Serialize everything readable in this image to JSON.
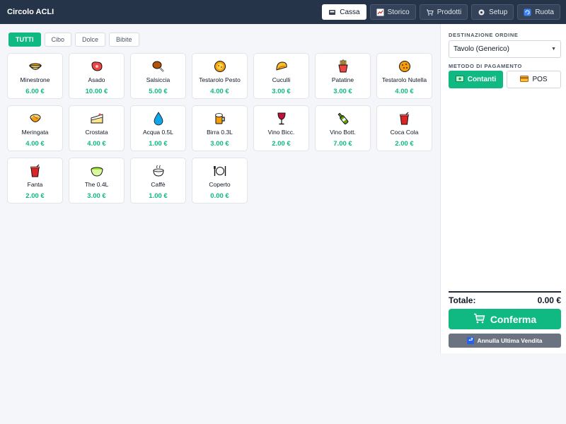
{
  "header": {
    "title": "Circolo ACLI",
    "nav": [
      {
        "label": "Cassa",
        "icon": "cash-register-icon",
        "active": true
      },
      {
        "label": "Storico",
        "icon": "chart-icon",
        "active": false
      },
      {
        "label": "Prodotti",
        "icon": "cart-icon",
        "active": false
      },
      {
        "label": "Setup",
        "icon": "gear-icon",
        "active": false
      },
      {
        "label": "Ruota",
        "icon": "refresh-icon",
        "active": false
      }
    ]
  },
  "filters": [
    {
      "label": "TUTTI",
      "active": true
    },
    {
      "label": "Cibo",
      "active": false
    },
    {
      "label": "Dolce",
      "active": false
    },
    {
      "label": "Bibite",
      "active": false
    }
  ],
  "products": [
    {
      "name": "Minestrone",
      "price": "6.00 €",
      "icon": "soup-bowl-icon"
    },
    {
      "name": "Asado",
      "price": "10.00 €",
      "icon": "meat-icon"
    },
    {
      "name": "Salsiccia",
      "price": "5.00 €",
      "icon": "drumstick-icon"
    },
    {
      "name": "Testarolo Pesto",
      "price": "4.00 €",
      "icon": "flatbread-icon"
    },
    {
      "name": "Cuculli",
      "price": "3.00 €",
      "icon": "taco-icon"
    },
    {
      "name": "Patatine",
      "price": "3.00 €",
      "icon": "fries-icon"
    },
    {
      "name": "Testarolo Nutella",
      "price": "4.00 €",
      "icon": "cookie-icon"
    },
    {
      "name": "Meringata",
      "price": "4.00 €",
      "icon": "pie-icon"
    },
    {
      "name": "Crostata",
      "price": "4.00 €",
      "icon": "cake-slice-icon"
    },
    {
      "name": "Acqua 0.5L",
      "price": "1.00 €",
      "icon": "water-drop-icon"
    },
    {
      "name": "Birra 0.3L",
      "price": "3.00 €",
      "icon": "beer-mug-icon"
    },
    {
      "name": "Vino Bicc.",
      "price": "2.00 €",
      "icon": "wine-glass-icon"
    },
    {
      "name": "Vino Bott.",
      "price": "7.00 €",
      "icon": "wine-bottle-icon"
    },
    {
      "name": "Coca Cola",
      "price": "2.00 €",
      "icon": "soda-cup-icon"
    },
    {
      "name": "Fanta",
      "price": "2.00 €",
      "icon": "soda-cup-icon"
    },
    {
      "name": "The 0.4L",
      "price": "3.00 €",
      "icon": "tea-bowl-icon"
    },
    {
      "name": "Caffè",
      "price": "1.00 €",
      "icon": "coffee-icon"
    },
    {
      "name": "Coperto",
      "price": "0.00 €",
      "icon": "cutlery-plate-icon"
    }
  ],
  "order": {
    "destination_label": "DESTINAZIONE ORDINE",
    "destination_value": "Tavolo (Generico)",
    "payment_label": "METODO DI PAGAMENTO",
    "payment_options": [
      {
        "label": "Contanti",
        "icon": "banknote-icon",
        "active": true
      },
      {
        "label": "POS",
        "icon": "credit-card-icon",
        "active": false
      }
    ],
    "total_label": "Totale:",
    "total_value": "0.00 €",
    "confirm_label": "Conferma",
    "undo_label": "Annulla Ultima Vendita"
  },
  "colors": {
    "header_bg": "#263449",
    "accent": "#10b981",
    "undo_bg": "#6b7280"
  }
}
